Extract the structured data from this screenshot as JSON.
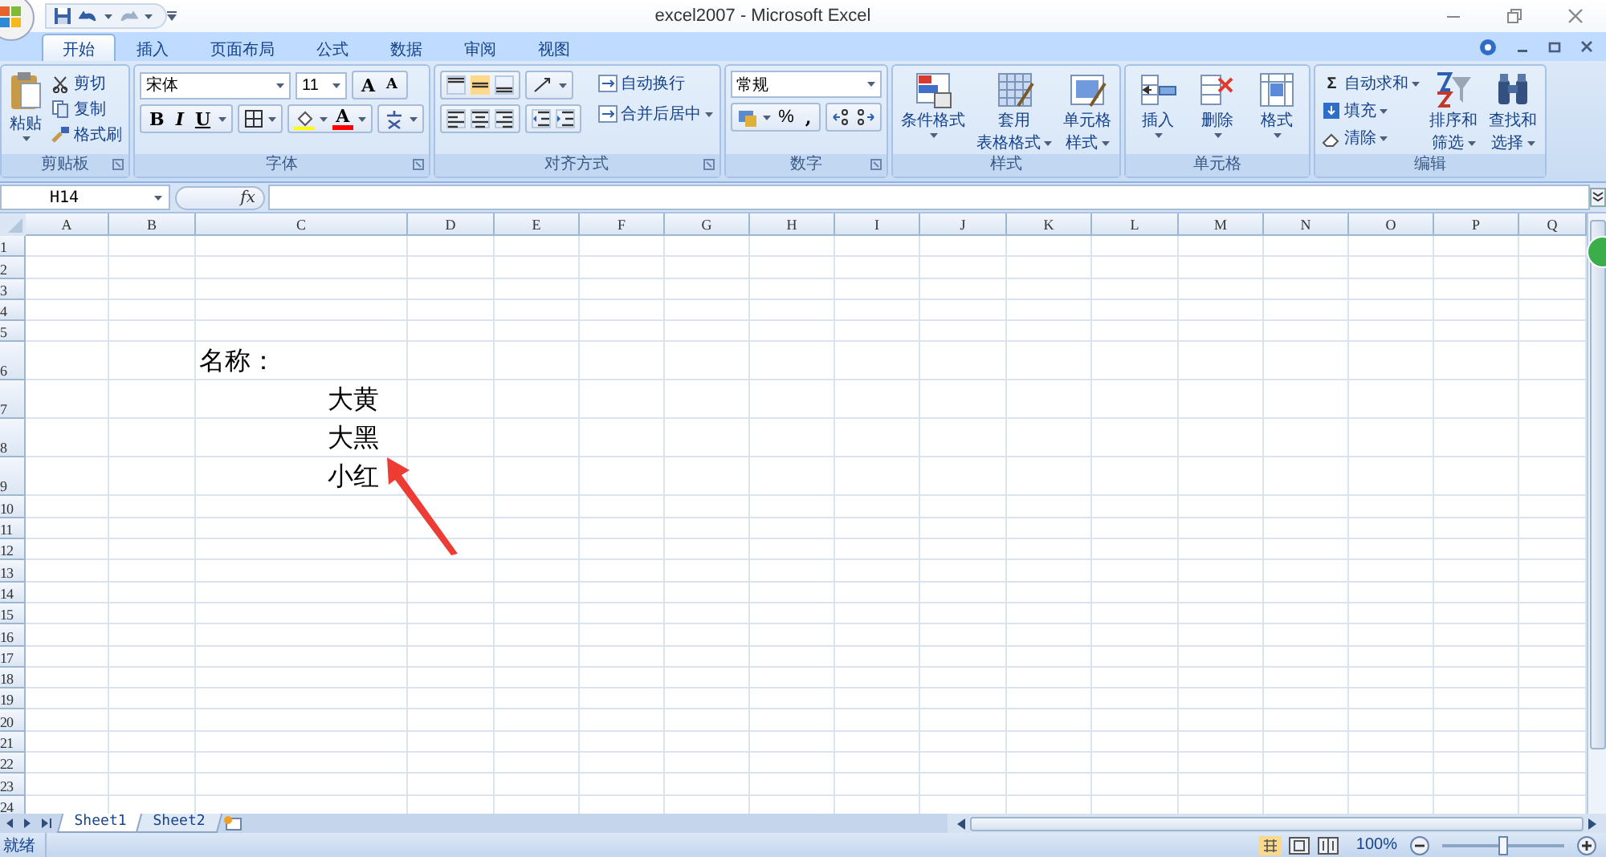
{
  "window": {
    "title": "excel2007 - Microsoft Excel"
  },
  "tabs": [
    {
      "label": "开始",
      "selected": true
    },
    {
      "label": "插入",
      "selected": false
    },
    {
      "label": "页面布局",
      "selected": false
    },
    {
      "label": "公式",
      "selected": false
    },
    {
      "label": "数据",
      "selected": false
    },
    {
      "label": "审阅",
      "selected": false
    },
    {
      "label": "视图",
      "selected": false
    }
  ],
  "ribbon_groups": [
    {
      "kind": "clipboard",
      "name": "剪贴板",
      "paste": "粘贴",
      "items": [
        "剪切",
        "复制",
        "格式刷"
      ]
    },
    {
      "kind": "font",
      "name": "字体",
      "font_name": "宋体",
      "font_size": "11",
      "grow": "A",
      "shrink": "A",
      "bold": "B",
      "italic": "I",
      "underline": "U",
      "font_color": "A"
    },
    {
      "kind": "alignment",
      "name": "对齐方式",
      "items": [
        "自动换行",
        "合并后居中"
      ]
    },
    {
      "kind": "number",
      "name": "数字",
      "format": "常规",
      "percent": "%",
      "comma": ","
    },
    {
      "kind": "large",
      "name": "样式",
      "buttons": [
        {
          "lines": [
            "条件格式"
          ]
        },
        {
          "lines": [
            "套用",
            "表格格式"
          ]
        },
        {
          "lines": [
            "单元格",
            "样式"
          ]
        }
      ]
    },
    {
      "kind": "large",
      "name": "单元格",
      "buttons": [
        {
          "lines": [
            "插入"
          ]
        },
        {
          "lines": [
            "删除"
          ]
        },
        {
          "lines": [
            "格式"
          ]
        }
      ]
    },
    {
      "kind": "editing",
      "name": "编辑",
      "small_items": [
        {
          "symbol": "Σ",
          "label": "自动求和"
        },
        {
          "label": "填充"
        },
        {
          "label": "清除"
        }
      ],
      "buttons": [
        {
          "lines": [
            "排序和",
            "筛选"
          ]
        },
        {
          "lines": [
            "查找和",
            "选择"
          ]
        }
      ]
    }
  ],
  "formula_bar": {
    "name_box": "H14",
    "fx": "fx"
  },
  "sheet": {
    "columns": [
      "A",
      "B",
      "C",
      "D",
      "E",
      "F",
      "G",
      "H",
      "I",
      "J",
      "K",
      "L",
      "M",
      "N",
      "O",
      "P",
      "Q"
    ],
    "rows": [
      {
        "label": "1",
        "tall": false
      },
      {
        "label": "2",
        "tall": false
      },
      {
        "label": "3",
        "tall": false
      },
      {
        "label": "4",
        "tall": false
      },
      {
        "label": "5",
        "tall": false
      },
      {
        "label": "6",
        "tall": true,
        "C": {
          "text": "名称：",
          "kind": "plain"
        }
      },
      {
        "label": "7",
        "tall": true,
        "C": {
          "text": "大黄",
          "kind": "indented"
        }
      },
      {
        "label": "8",
        "tall": true,
        "C": {
          "text": "大黑",
          "kind": "indented"
        }
      },
      {
        "label": "9",
        "tall": true,
        "C": {
          "text": "小红",
          "kind": "indented"
        }
      },
      {
        "label": "10",
        "tall": false
      },
      {
        "label": "11",
        "tall": false
      },
      {
        "label": "12",
        "tall": false
      },
      {
        "label": "13",
        "tall": false
      },
      {
        "label": "14",
        "tall": false
      },
      {
        "label": "15",
        "tall": false
      },
      {
        "label": "16",
        "tall": false
      },
      {
        "label": "17",
        "tall": false
      },
      {
        "label": "18",
        "tall": false
      },
      {
        "label": "19",
        "tall": false
      },
      {
        "label": "20",
        "tall": false
      },
      {
        "label": "21",
        "tall": false
      },
      {
        "label": "22",
        "tall": false
      },
      {
        "label": "23",
        "tall": false
      },
      {
        "label": "24",
        "tall": false
      }
    ]
  },
  "sheet_tabs": [
    {
      "label": "Sheet1",
      "selected": true
    },
    {
      "label": "Sheet2",
      "selected": false
    }
  ],
  "status_bar": {
    "text": "就绪",
    "zoom": "100%",
    "zoom_level": {
      "level": 0.5
    }
  }
}
